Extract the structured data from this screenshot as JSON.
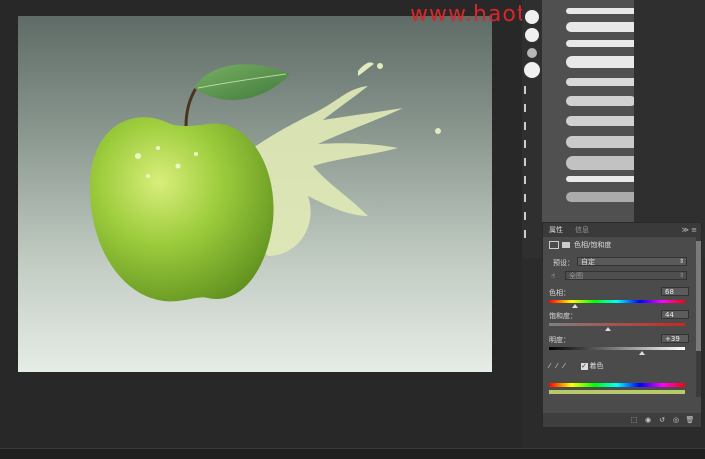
{
  "watermark": "www.haotujiaoshe.com",
  "properties": {
    "tab_active": "属性",
    "tab_inactive": "信息",
    "panel_type": "色相/饱和度",
    "preset_label": "预设：",
    "preset_value": "自定",
    "channel_value": "全图",
    "hue_label": "色相：",
    "hue_value": "68",
    "saturation_label": "饱和度：",
    "saturation_value": "44",
    "lightness_label": "明度：",
    "lightness_value": "+39",
    "colorize_label": "着色",
    "colorize_checked": true
  },
  "colors": {
    "accent_red": "#d9262a",
    "apple_green": "#8fc13a",
    "leaf_green": "#5e9d4f"
  }
}
